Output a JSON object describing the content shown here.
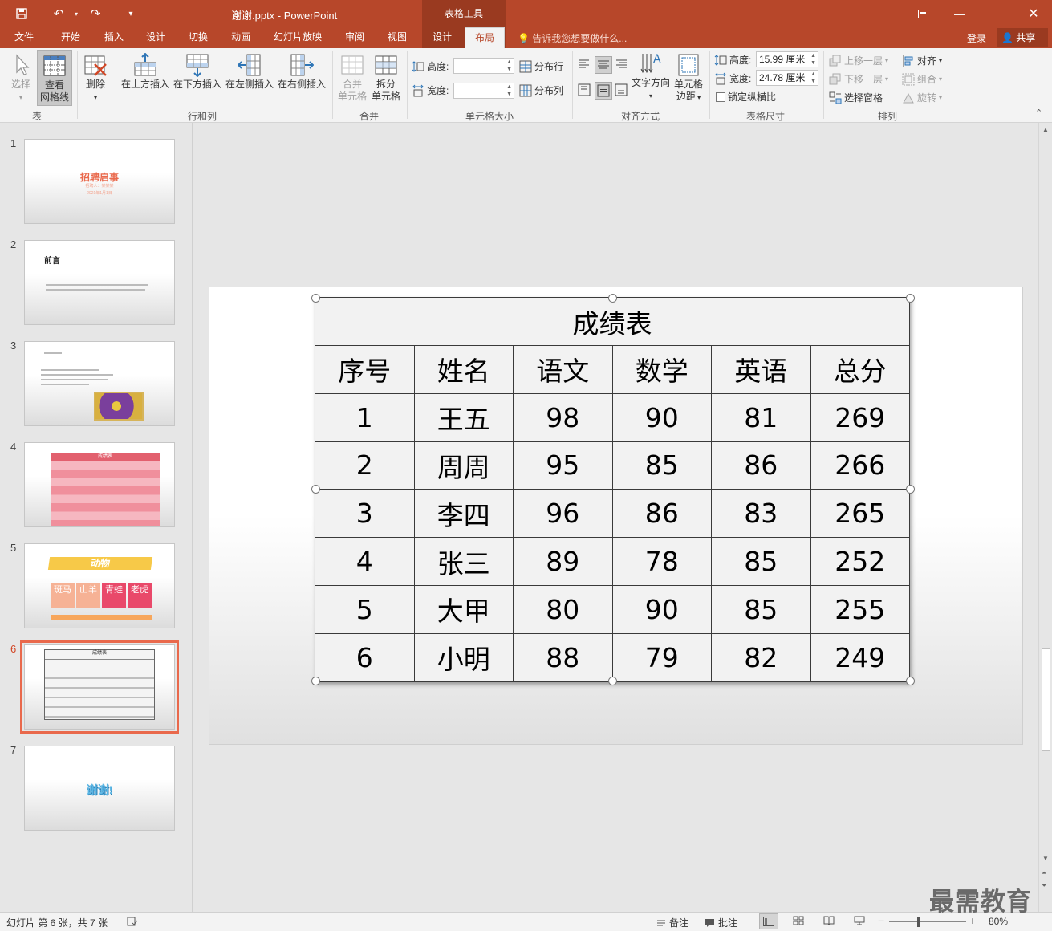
{
  "titlebar": {
    "doc_title": "谢谢.pptx - PowerPoint",
    "tools_context": "表格工具"
  },
  "tabs": [
    "文件",
    "开始",
    "插入",
    "设计",
    "切换",
    "动画",
    "幻灯片放映",
    "审阅",
    "视图",
    "设计",
    "布局"
  ],
  "tellme": "告诉我您想要做什么...",
  "account": {
    "login": "登录",
    "share": "共享"
  },
  "ribbon": {
    "select": "选择",
    "view_grid_1": "查看",
    "view_grid_2": "网格线",
    "group_table": "表",
    "delete": "删除",
    "insert_above": "在上方插入",
    "insert_below": "在下方插入",
    "insert_left": "在左侧插入",
    "insert_right": "在右侧插入",
    "group_rowcol": "行和列",
    "merge_1": "合并",
    "merge_2": "单元格",
    "split_1": "拆分",
    "split_2": "单元格",
    "group_merge": "合并",
    "cell_height": "高度:",
    "cell_width": "宽度:",
    "dist_rows": "分布行",
    "dist_cols": "分布列",
    "group_cellsize": "单元格大小",
    "text_dir": "文字方向",
    "cell_margin_1": "单元格",
    "cell_margin_2": "边距",
    "group_align": "对齐方式",
    "tbl_height_label": "高度:",
    "tbl_height_val": "15.99 厘米",
    "tbl_width_label": "宽度:",
    "tbl_width_val": "24.78 厘米",
    "lock_ratio": "锁定纵横比",
    "group_tablesize": "表格尺寸",
    "bring_forward": "上移一层",
    "send_backward": "下移一层",
    "selection_pane": "选择窗格",
    "align": "对齐",
    "group": "组合",
    "rotate": "旋转",
    "group_arrange": "排列"
  },
  "thumbnails": {
    "numbers": [
      "1",
      "2",
      "3",
      "4",
      "5",
      "6",
      "7"
    ],
    "s1_title": "招聘启事",
    "s1_sub": "招聘人：某某某",
    "s1_date": "2021年1月1日",
    "s2_title": "前言",
    "s4_title": "成绩表",
    "s5_title": "动物",
    "s5_cells": [
      "斑马",
      "山羊",
      "青蛙",
      "老虎"
    ],
    "s6_title": "成绩表",
    "s7_title": "谢谢!"
  },
  "table": {
    "caption": "成绩表",
    "headers": [
      "序号",
      "姓名",
      "语文",
      "数学",
      "英语",
      "总分"
    ],
    "rows": [
      [
        "1",
        "王五",
        "98",
        "90",
        "81",
        "269"
      ],
      [
        "2",
        "周周",
        "95",
        "85",
        "86",
        "266"
      ],
      [
        "3",
        "李四",
        "96",
        "86",
        "83",
        "265"
      ],
      [
        "4",
        "张三",
        "89",
        "78",
        "85",
        "252"
      ],
      [
        "5",
        "大甲",
        "80",
        "90",
        "85",
        "255"
      ],
      [
        "6",
        "小明",
        "88",
        "79",
        "82",
        "249"
      ]
    ]
  },
  "status": {
    "slide_info": "幻灯片 第 6 张，共 7 张",
    "notes": "备注",
    "comments": "批注",
    "zoom": "80%"
  },
  "watermark": "最需教育",
  "colors": {
    "accent": "#b7472a",
    "selection": "#e9694c"
  }
}
